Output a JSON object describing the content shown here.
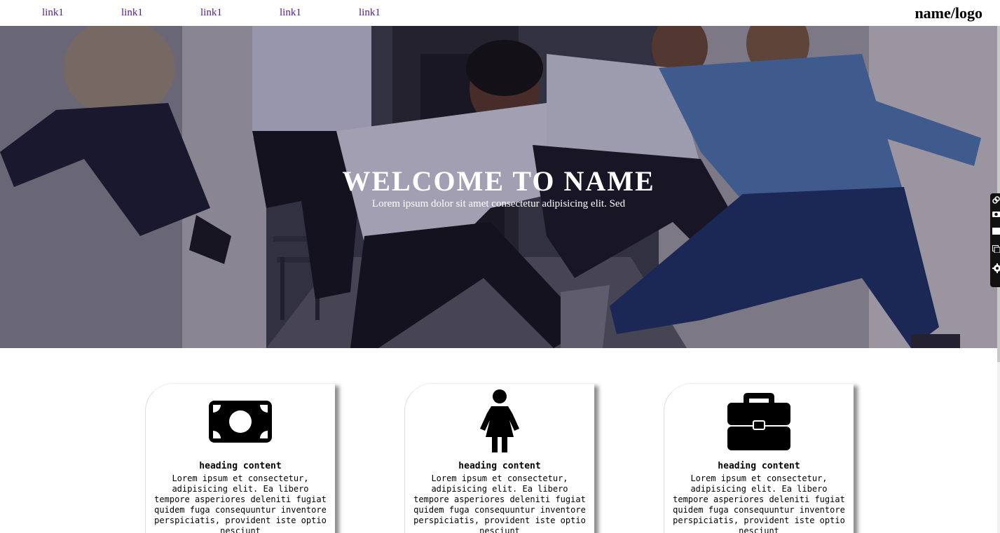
{
  "nav": {
    "links": [
      "link1",
      "link1",
      "link1",
      "link1",
      "link1"
    ],
    "brand": "name/logo"
  },
  "hero": {
    "title": "WELCOME TO NAME",
    "subtitle": "Lorem ipsum dolor sit amet consectetur adipisicing elit. Sed"
  },
  "cards": [
    {
      "icon": "money-bill-icon",
      "heading": "heading content",
      "text": "Lorem ipsum et consectetur, adipisicing elit. Ea libero tempore asperiores deleniti fugiat quidem fuga consequuntur inventore perspiciatis, provident iste optio nesciunt"
    },
    {
      "icon": "female-person-icon",
      "heading": "heading content",
      "text": "Lorem ipsum et consectetur, adipisicing elit. Ea libero tempore asperiores deleniti fugiat quidem fuga consequuntur inventore perspiciatis, provident iste optio nesciunt"
    },
    {
      "icon": "briefcase-icon",
      "heading": "heading content",
      "text": "Lorem ipsum et consectetur, adipisicing elit. Ea libero tempore asperiores deleniti fugiat quidem fuga consequuntur inventore perspiciatis, provident iste optio nesciunt"
    }
  ],
  "side_toolbar": {
    "icons": [
      "link-icon",
      "camera-icon",
      "square-icon",
      "copy-icon",
      "gear-icon"
    ]
  },
  "colors": {
    "nav_link": "#551a8b",
    "hero_text": "#ffffff",
    "icon": "#000000"
  }
}
